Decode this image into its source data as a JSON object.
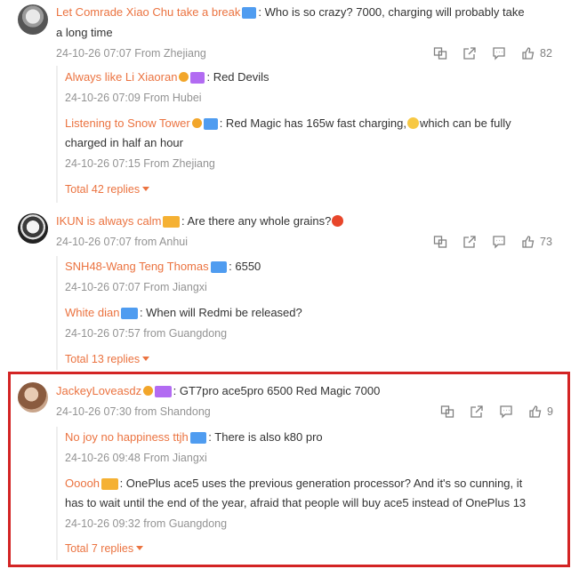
{
  "comments": [
    {
      "name": "Let Comrade Xiao Chu take a break",
      "text": ": Who is so crazy? 7000, charging will probably take",
      "text2": "a long time",
      "meta": "24-10-26 07:07 From Zhejiang",
      "likes": "82",
      "replies": [
        {
          "name": "Always like Li Xiaoran",
          "text": ": Red Devils",
          "meta": "24-10-26 07:09 From Hubei"
        },
        {
          "name": "Listening to Snow Tower",
          "text_a": ": Red Magic has 165w fast charging,",
          "text_b": "which can be fully",
          "text2": "charged in half an hour",
          "meta": "24-10-26 07:15 From Zhejiang"
        }
      ],
      "more": "Total 42 replies"
    },
    {
      "name": "IKUN is always calm",
      "text": ": Are there any whole grains?",
      "meta": "24-10-26 07:07 from Anhui",
      "likes": "73",
      "replies": [
        {
          "name": "SNH48-Wang Teng Thomas",
          "text": ": 6550",
          "meta": "24-10-26 07:07 From Jiangxi"
        },
        {
          "name": "White dian",
          "text": ": When will Redmi be released?",
          "meta": "24-10-26 07:57 from Guangdong"
        }
      ],
      "more": "Total 13 replies"
    },
    {
      "name": "JackeyLoveasdz",
      "text": ": GT7pro ace5pro 6500 Red Magic 7000",
      "meta": "24-10-26 07:30 from Shandong",
      "likes": "9",
      "replies": [
        {
          "name": "No joy no happiness ttjh",
          "text": ": There is also k80 pro",
          "meta": "24-10-26 09:48 From Jiangxi"
        },
        {
          "name": "Ooooh",
          "text": ": OnePlus ace5 uses the previous generation processor? And it's so cunning, it",
          "text2": "has to wait until the end of the year, afraid that people will buy ace5 instead of OnePlus 13",
          "meta": "24-10-26 09:32 from Guangdong"
        }
      ],
      "more": "Total 7 replies"
    }
  ]
}
